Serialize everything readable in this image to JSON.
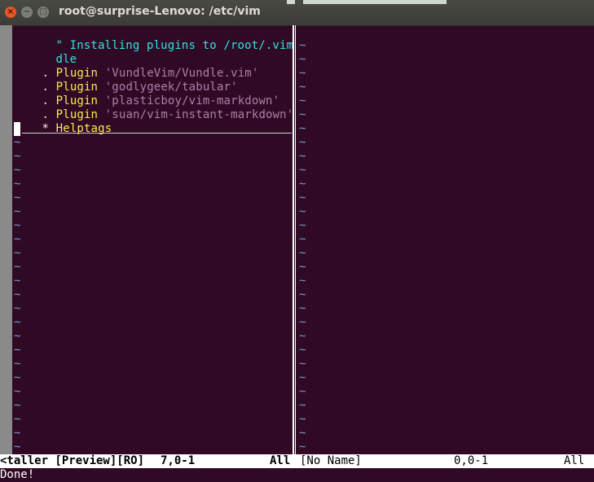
{
  "window": {
    "title": "root@surprise-Lenovo: /etc/vim",
    "close_glyph": "×",
    "minimize_glyph": "−",
    "maximize_glyph": "□"
  },
  "left_buffer": {
    "lines": [
      {
        "prefix": "",
        "keyword": "\" Installing plugins to /root/.vim/bun",
        "arg": ""
      },
      {
        "prefix": "",
        "keyword": "dle",
        "arg": ""
      },
      {
        "prefix": ". ",
        "keyword": "Plugin ",
        "arg": "'VundleVim/Vundle.vim'"
      },
      {
        "prefix": ". ",
        "keyword": "Plugin ",
        "arg": "'godlygeek/tabular'"
      },
      {
        "prefix": ". ",
        "keyword": "Plugin ",
        "arg": "'plasticboy/vim-markdown'"
      },
      {
        "prefix": ". ",
        "keyword": "Plugin ",
        "arg": "'suan/vim-instant-markdown'"
      },
      {
        "prefix": "* ",
        "keyword": "Helptags",
        "arg": ""
      }
    ],
    "tilde": "~"
  },
  "right_buffer": {
    "tilde": "~"
  },
  "statusline": {
    "left_name": "<taller [Preview][RO]",
    "left_pos": "7,0-1",
    "left_scroll": "All",
    "right_name": "[No Name]",
    "right_pos": "0,0-1",
    "right_scroll": "All"
  },
  "command_line": "Done!",
  "colors": {
    "background": "#300a24",
    "comment": "#34e2e2",
    "keyword": "#fce94f",
    "string": "#ad7fa8",
    "tilde": "#729fcf"
  }
}
